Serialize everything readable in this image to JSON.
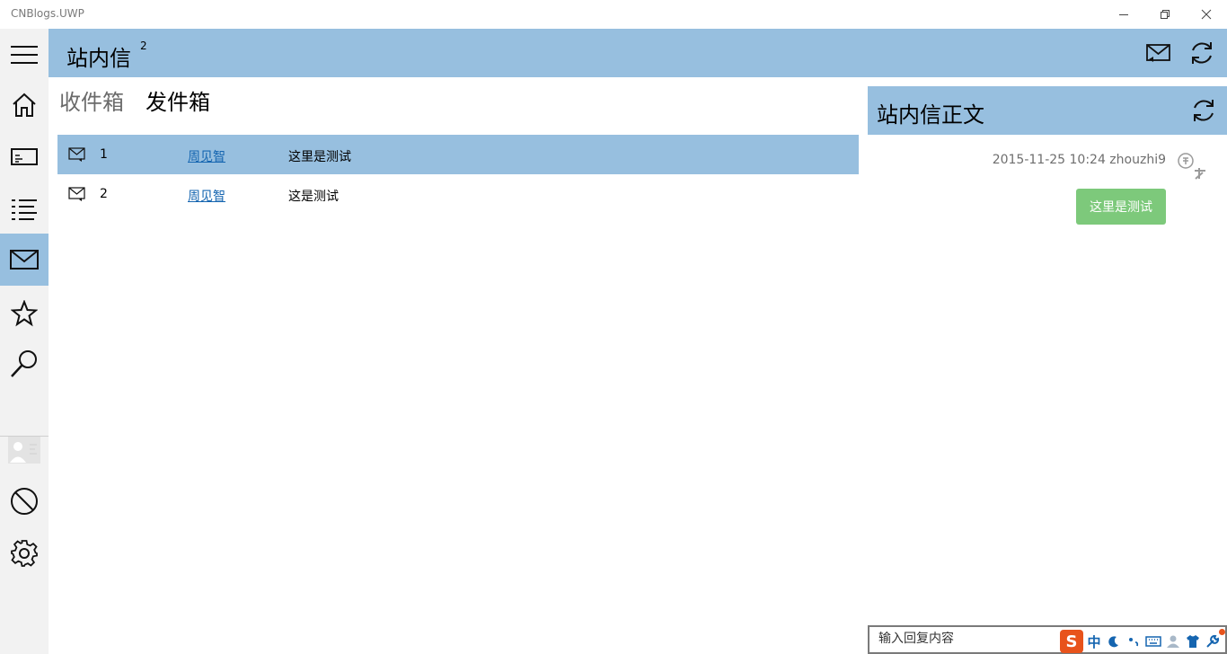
{
  "app": {
    "title": "CNBlogs.UWP"
  },
  "header": {
    "title": "站内信",
    "unread_count": "2"
  },
  "tabs": [
    {
      "label": "收件箱",
      "active": false
    },
    {
      "label": "发件箱",
      "active": true
    }
  ],
  "messages": [
    {
      "num": "1",
      "sender": "周见智",
      "subject": "这里是测试",
      "selected": true
    },
    {
      "num": "2",
      "sender": "周见智",
      "subject": "这是测试",
      "selected": false
    }
  ],
  "detail": {
    "title": "站内信正文",
    "meta": "2015-11-25 10:24 zhouzhi9",
    "body": "这里是测试",
    "reply_placeholder": "输入回复内容"
  },
  "ime": {
    "logo": "S",
    "mode": "中"
  },
  "sidebar_icons": [
    "menu-icon",
    "home-icon",
    "news-icon",
    "list-icon",
    "mail-icon",
    "star-icon",
    "search-icon",
    "avatar",
    "block-icon",
    "gear-icon"
  ],
  "colors": {
    "accent": "#97bfdf",
    "sidebar": "#f2f2f2",
    "bubble": "#7dc97b",
    "link": "#1565b0"
  }
}
